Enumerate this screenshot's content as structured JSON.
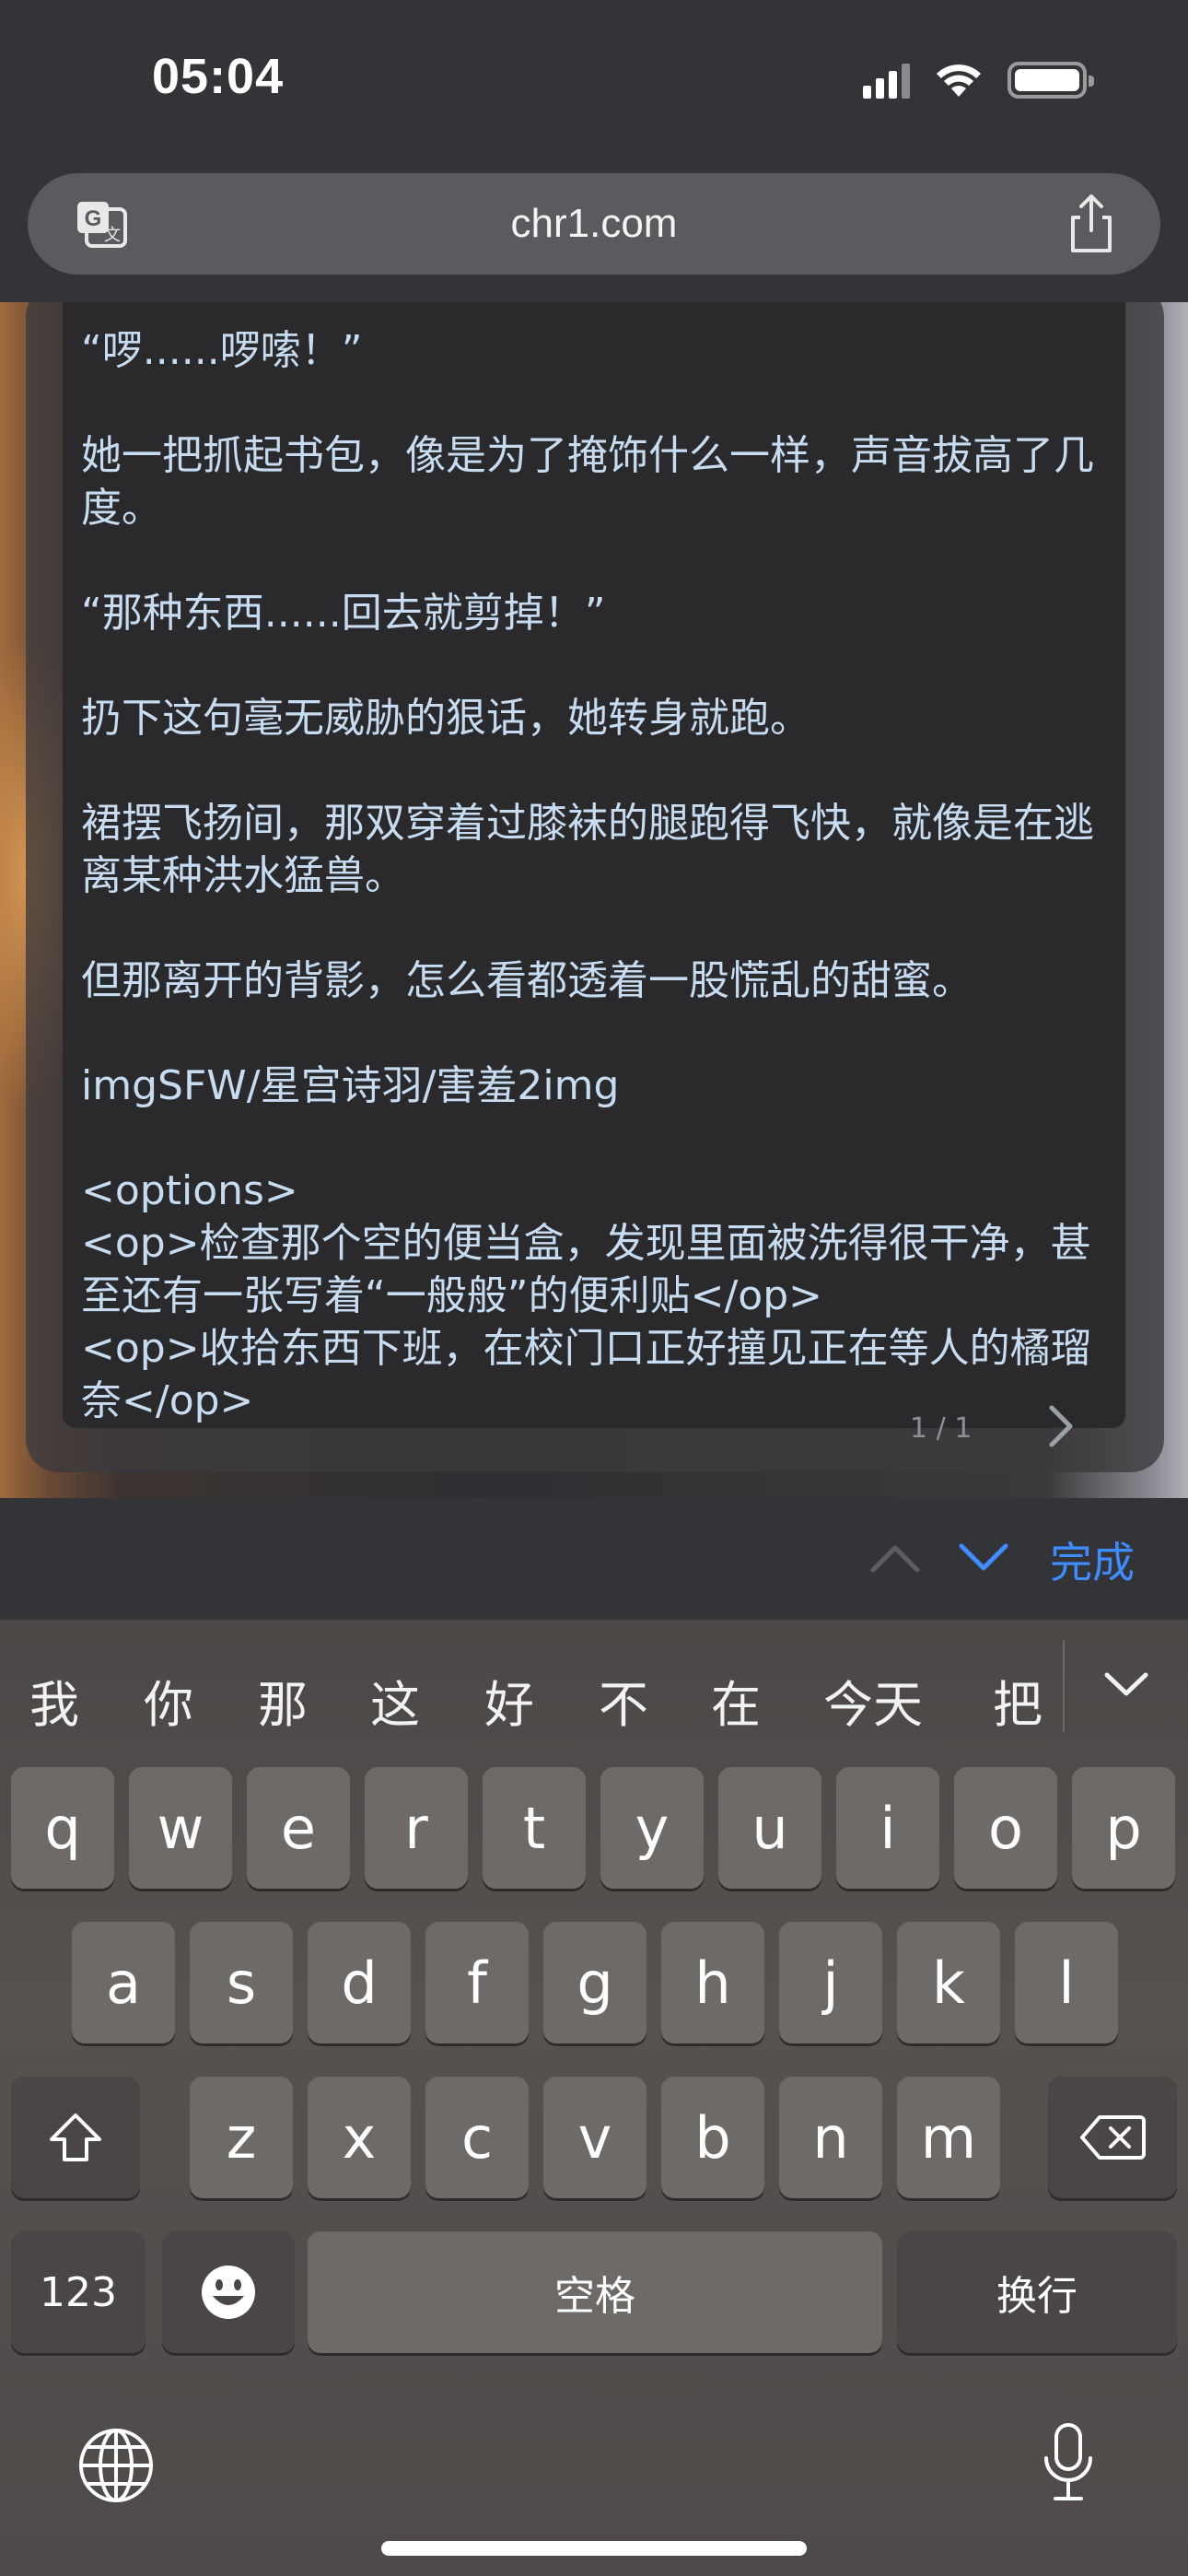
{
  "status_bar": {
    "time": "05:04"
  },
  "browser": {
    "url": "chr1.com"
  },
  "story": {
    "paragraphs": [
      "“啰......啰嗦！”",
      "她一把抓起书包，像是为了掩饰什么一样，声音拔高了几度。",
      "“那种东西......回去就剪掉！”",
      "扔下这句毫无威胁的狠话，她转身就跑。",
      "裙摆飞扬间，那双穿着过膝袜的腿跑得飞快，就像是在逃离某种洪水猛兽。",
      "但那离开的背影，怎么看都透着一股慌乱的甜蜜。",
      "imgSFW/星宫诗羽/害羞2img"
    ],
    "options_open": "<options>",
    "options": [
      "<op>检查那个空的便当盒，发现里面被洗得很干净，甚至还有一张写着“一般般”的便利贴</op>",
      "<op>收拾东西下班，在校门口正好撞见正在等人的橘瑠奈</op>"
    ],
    "pager": "1 / 1"
  },
  "find_bar": {
    "done_label": "完成"
  },
  "keyboard": {
    "candidates": [
      "我",
      "你",
      "那",
      "这",
      "好",
      "不",
      "在",
      "今天",
      "把"
    ],
    "row1": [
      "q",
      "w",
      "e",
      "r",
      "t",
      "y",
      "u",
      "i",
      "o",
      "p"
    ],
    "row2": [
      "a",
      "s",
      "d",
      "f",
      "g",
      "h",
      "j",
      "k",
      "l"
    ],
    "row3": [
      "z",
      "x",
      "c",
      "v",
      "b",
      "n",
      "m"
    ],
    "numbers_label": "123",
    "space_label": "空格",
    "return_label": "换行"
  },
  "icons": {
    "status": [
      "signal-icon",
      "wifi-icon",
      "battery-icon"
    ],
    "browser": [
      "translate-icon",
      "share-icon"
    ],
    "find": [
      "chevron-up-icon",
      "chevron-down-icon"
    ],
    "keyboard": [
      "shift-icon",
      "delete-icon",
      "emoji-icon",
      "globe-icon",
      "mic-icon",
      "chevron-down-icon"
    ]
  },
  "colors": {
    "story_text": "#c7dcf0",
    "accent": "#3f8cff",
    "key": "#6e6a68",
    "key_dark": "#4a4645"
  }
}
